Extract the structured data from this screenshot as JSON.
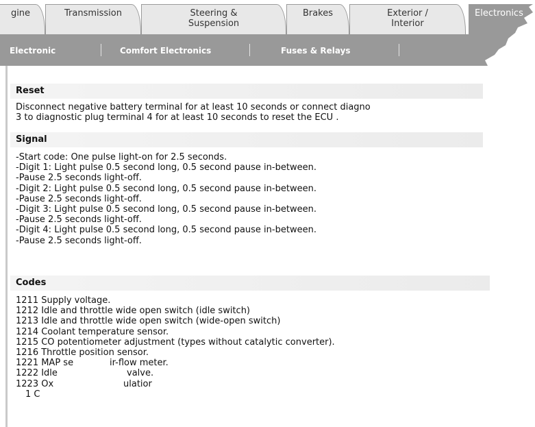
{
  "tabs": [
    {
      "label1": "gine",
      "label2": ""
    },
    {
      "label1": "Transmission",
      "label2": ""
    },
    {
      "label1": "Steering &",
      "label2": "Suspension"
    },
    {
      "label1": "Brakes",
      "label2": ""
    },
    {
      "label1": "Exterior /",
      "label2": "Interior"
    },
    {
      "label1": "Electronics",
      "label2": ""
    }
  ],
  "subnav": [
    "Electronic",
    "Comfort Electronics",
    "Fuses & Relays"
  ],
  "sections": {
    "reset": {
      "title": "Reset",
      "lines": [
        "Disconnect negative battery terminal for at least 10 seconds or connect diagno",
        "3 to diagnostic plug terminal 4 for at least 10 seconds to reset the ECU ."
      ]
    },
    "signal": {
      "title": "Signal",
      "lines": [
        "-Start code: One pulse light-on for 2.5 seconds.",
        "-Digit 1: Light pulse 0.5 second long, 0.5 second pause in-between.",
        "-Pause 2.5 seconds light-off.",
        "-Digit 2: Light pulse 0.5 second long, 0.5 second pause in-between.",
        "-Pause 2.5 seconds light-off.",
        "-Digit 3: Light pulse 0.5 second long, 0.5 second pause in-between.",
        "-Pause 2.5 seconds light-off.",
        "-Digit 4: Light pulse 0.5 second long, 0.5 second pause in-between.",
        "-Pause 2.5 seconds light-off."
      ]
    },
    "codes": {
      "title": "Codes",
      "lines": [
        "1211 Supply voltage.",
        "1212 Idle and throttle wide open switch (idle switch)",
        "1213 Idle and throttle wide open switch (wide-open switch)",
        "1214 Coolant temperature sensor.",
        "1215 CO potentiometer adjustment (types without catalytic converter).",
        "1216 Throttle position sensor.",
        "1221 MAP se",
        "1222 Idle",
        "1223 Ox",
        "1 C"
      ],
      "fragments": [
        "ir-flow meter.",
        "valve.",
        "ulatior"
      ]
    }
  },
  "colors": {
    "nav_gray": "#999999",
    "tab_inactive": "#e8e8e8",
    "section_head": "#f0f0f0"
  }
}
